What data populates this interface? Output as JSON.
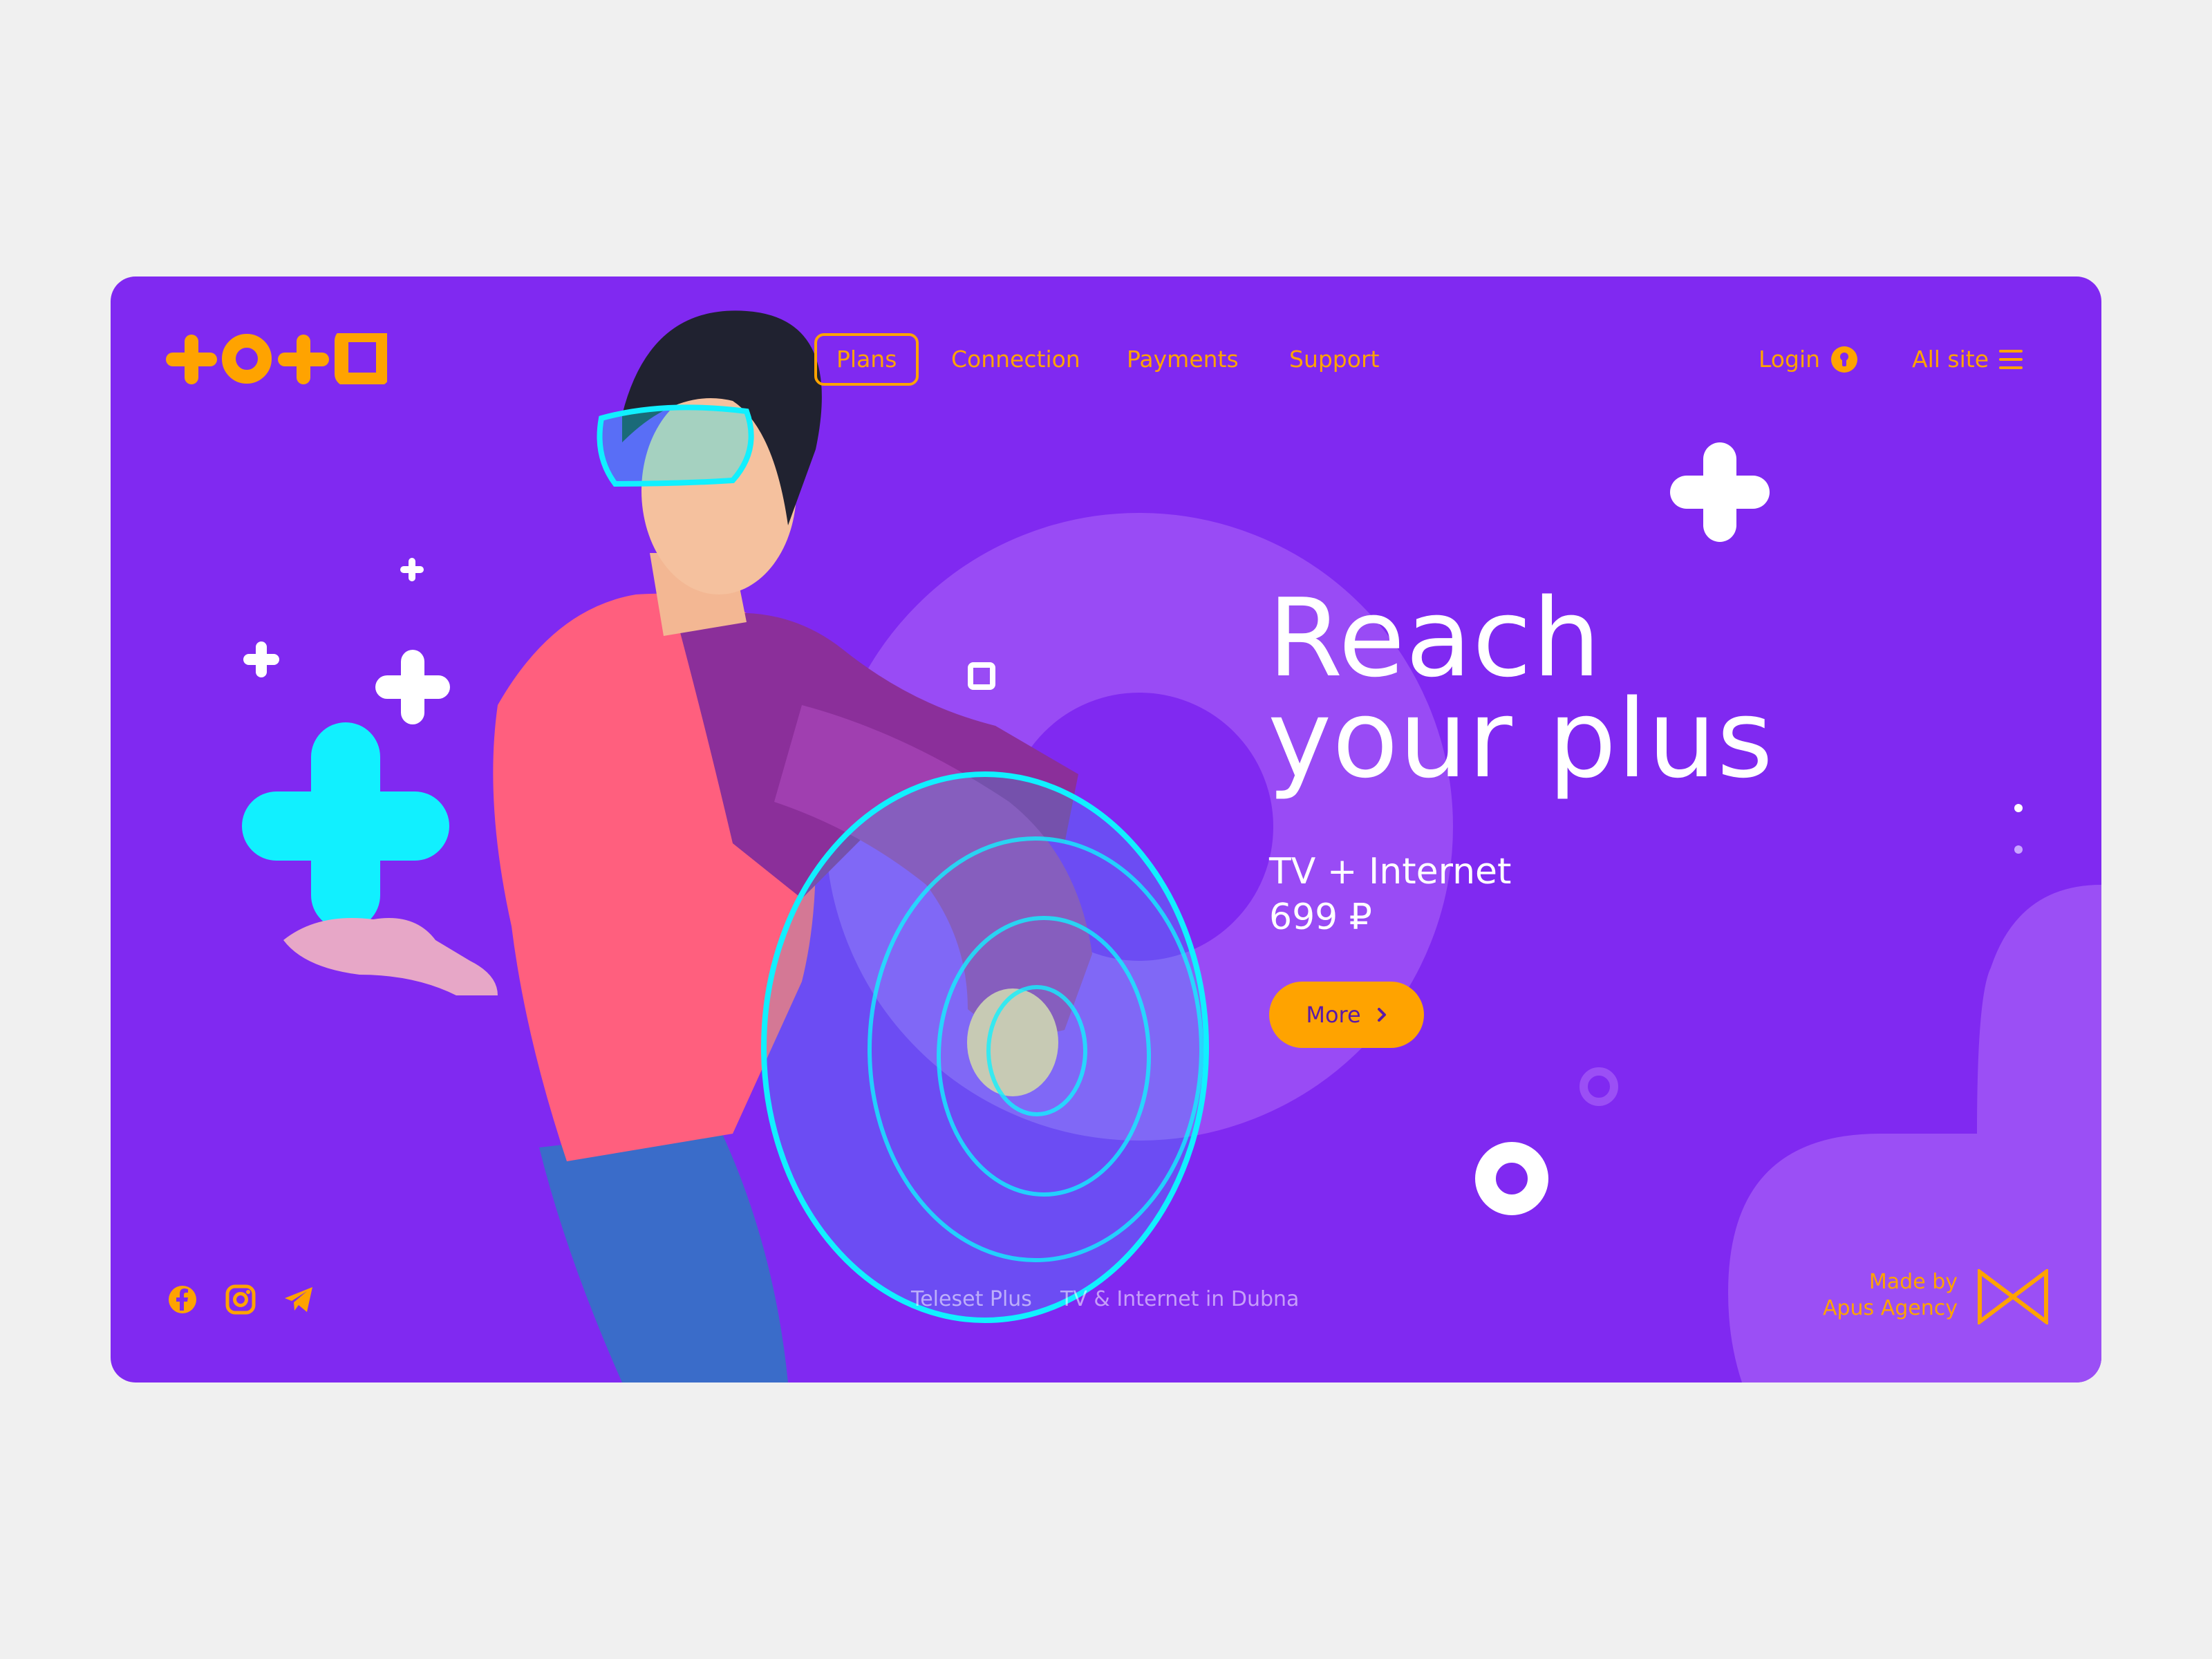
{
  "brand": {
    "logo_icon": "toto-logo-icon",
    "accent": "#ffa300",
    "background": "#8029f1",
    "cyan": "#11f0ff"
  },
  "nav": {
    "items": [
      {
        "label": "Plans",
        "active": true
      },
      {
        "label": "Connection",
        "active": false
      },
      {
        "label": "Payments",
        "active": false
      },
      {
        "label": "Support",
        "active": false
      }
    ],
    "login": {
      "label": "Login",
      "icon": "keyhole-icon"
    },
    "all_site": {
      "label": "All site",
      "icon": "menu-icon"
    }
  },
  "hero": {
    "title_line1": "Reach",
    "title_line2": "your plus",
    "subtitle_line1": "TV + Internet",
    "price": "699 ₽",
    "more_label": "More",
    "more_icon": "chevron-right-icon"
  },
  "footer": {
    "socials": [
      "facebook-icon",
      "instagram-icon",
      "telegram-icon"
    ],
    "company": "Teleset Plus",
    "tagline": "TV & Internet in Dubna",
    "made_by_line1": "Made by",
    "made_by_line2": "Apus Agency",
    "agency_logo": "apus-agency-logo-icon"
  }
}
